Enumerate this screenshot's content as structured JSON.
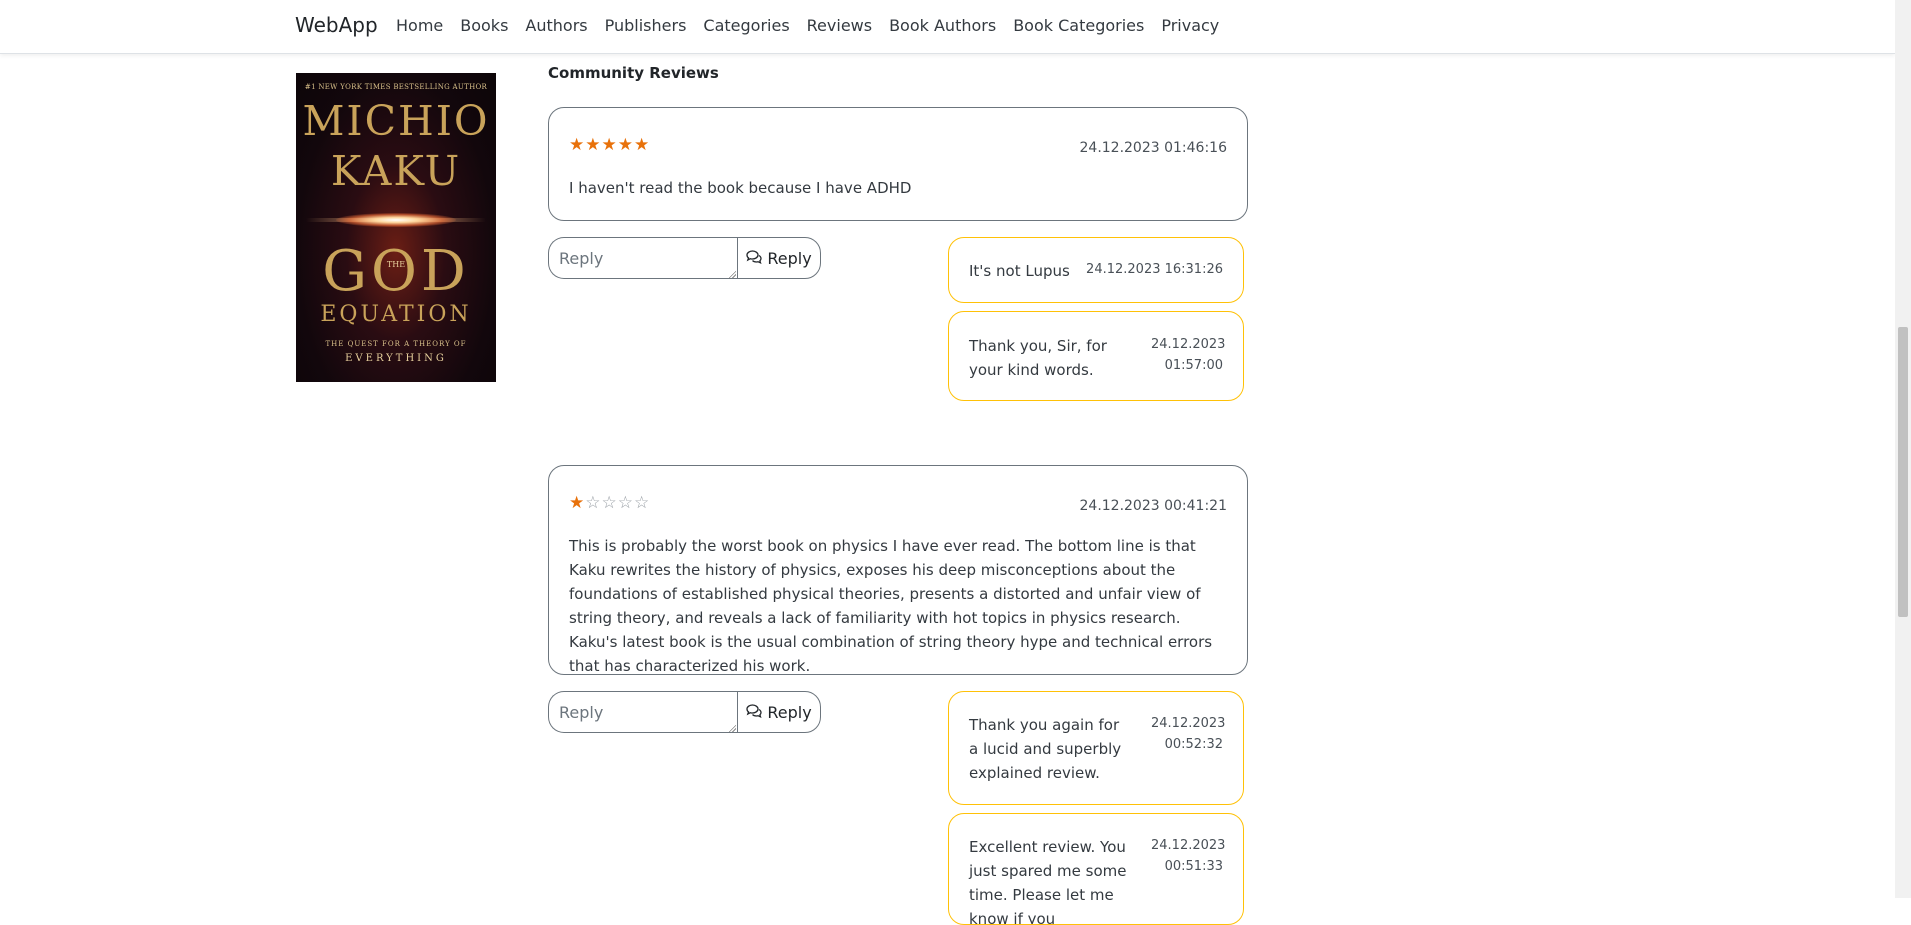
{
  "navbar": {
    "brand": "WebApp",
    "links": [
      "Home",
      "Books",
      "Authors",
      "Publishers",
      "Categories",
      "Reviews",
      "Book Authors",
      "Book Categories",
      "Privacy"
    ]
  },
  "book_cover": {
    "tagline": "#1 NEW YORK TIMES BESTSELLING AUTHOR",
    "author_line1": "MICHIO",
    "author_line2": "KAKU",
    "title_the": "THE",
    "title_god": "GOD",
    "title_equation": "EQUATION",
    "subtitle": "THE QUEST FOR A THEORY OF",
    "subtitle_last": "EVERYTHING"
  },
  "section_title": "Community Reviews",
  "reply_placeholder": "Reply",
  "reply_button": "Reply",
  "reviews": [
    {
      "rating": 5,
      "date": "24.12.2023 01:46:16",
      "text": "I haven't read the book because I have ADHD",
      "comments": [
        {
          "text": "It's not Lupus",
          "date": "24.12.2023 16:31:26"
        },
        {
          "text": "Thank you, Sir, for your kind words.",
          "date": "24.12.2023 01:57:00"
        }
      ]
    },
    {
      "rating": 1,
      "date": "24.12.2023 00:41:21",
      "text": "This is probably the worst book on physics I have ever read. The bottom line is that Kaku rewrites the history of physics, exposes his deep misconceptions about the foundations of established physical theories, presents a distorted and unfair view of string theory, and reveals a lack of familiarity with hot topics in physics research. Kaku's latest book is the usual combination of string theory hype and technical errors that has characterized his work.",
      "comments": [
        {
          "text": "Thank you again for a lucid and superbly explained review.",
          "date": "24.12.2023 00:52:32"
        },
        {
          "text": "Excellent review. You just spared me some time. Please let me know if you",
          "date": "24.12.2023 00:51:33"
        }
      ]
    }
  ],
  "colors": {
    "star_filled": "#e8710a",
    "comment_border": "#ffc107",
    "review_border": "#6c757d"
  }
}
